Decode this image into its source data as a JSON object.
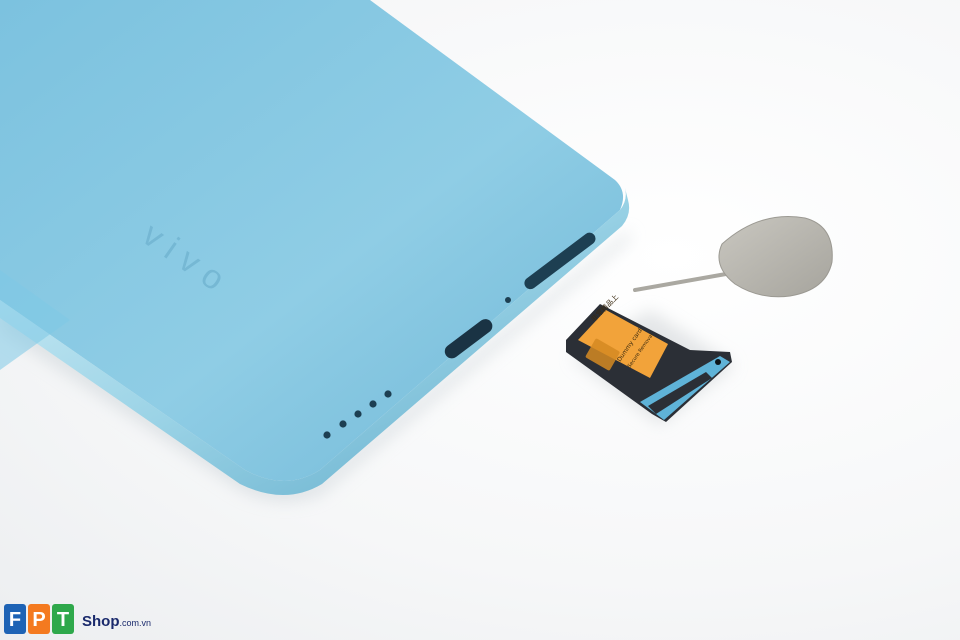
{
  "phone": {
    "brand_logo": "vivo",
    "body_color": "#8cc8e0",
    "frame_color": "#a9dcec"
  },
  "sim_tray": {
    "card_label_lines": [
      "非常精品上",
      "Dummy card",
      "Secure Removal"
    ],
    "card_color": "#f2a33a",
    "tray_color": "#2b2f36"
  },
  "ejector_tool": {
    "name": "sim-ejector-pin",
    "color": "#b7b5ae"
  },
  "watermark": {
    "logo_letters": [
      "F",
      "P",
      "T"
    ],
    "logo_colors": [
      "#1e63b5",
      "#f47a20",
      "#2ea84b"
    ],
    "caption": "Shop",
    "caption_suffix": ".com.vn"
  }
}
